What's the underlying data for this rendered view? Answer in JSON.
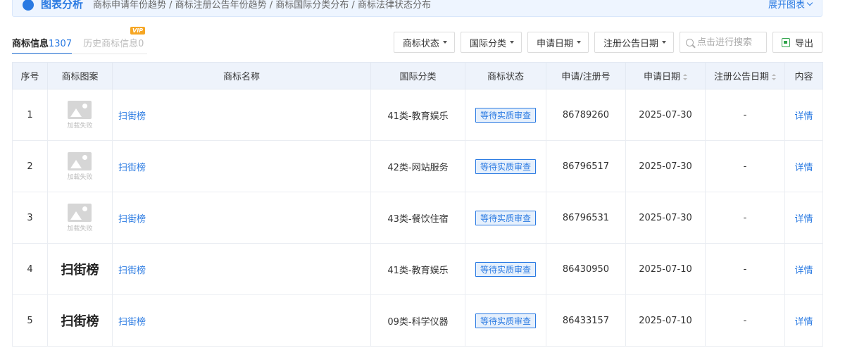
{
  "banner": {
    "title": "图表分析",
    "links": "商标申请年份趋势 / 商标注册公告年份趋势 / 商标国际分类分布 / 商标法律状态分布",
    "expand_label": "展开图表"
  },
  "tabs": [
    {
      "label": "商标信息",
      "count": "1307"
    },
    {
      "label": "历史商标信息",
      "count": "0",
      "badge": "VIP"
    }
  ],
  "toolbar": {
    "filters": [
      "商标状态",
      "国际分类",
      "申请日期",
      "注册公告日期"
    ],
    "search_placeholder": "点击进行搜索",
    "export_label": "导出"
  },
  "table": {
    "headers": [
      "序号",
      "商标图案",
      "商标名称",
      "国际分类",
      "商标状态",
      "申请/注册号",
      "申请日期",
      "注册公告日期",
      "内容"
    ],
    "image_fail_caption": "加载失败",
    "rows": [
      {
        "no": "1",
        "image": "failed",
        "mark_text": "",
        "name": "扫街榜",
        "class": "41类-教育娱乐",
        "status": "等待实质审查",
        "reg_no": "86789260",
        "apply_date": "2025-07-30",
        "announce_date": "-",
        "action": "详情"
      },
      {
        "no": "2",
        "image": "failed",
        "mark_text": "",
        "name": "扫街榜",
        "class": "42类-网站服务",
        "status": "等待实质审查",
        "reg_no": "86796517",
        "apply_date": "2025-07-30",
        "announce_date": "-",
        "action": "详情"
      },
      {
        "no": "3",
        "image": "failed",
        "mark_text": "",
        "name": "扫街榜",
        "class": "43类-餐饮住宿",
        "status": "等待实质审查",
        "reg_no": "86796531",
        "apply_date": "2025-07-30",
        "announce_date": "-",
        "action": "详情"
      },
      {
        "no": "4",
        "image": "text",
        "mark_text": "扫街榜",
        "name": "扫街榜",
        "class": "41类-教育娱乐",
        "status": "等待实质审查",
        "reg_no": "86430950",
        "apply_date": "2025-07-10",
        "announce_date": "-",
        "action": "详情"
      },
      {
        "no": "5",
        "image": "text",
        "mark_text": "扫街榜",
        "name": "扫街榜",
        "class": "09类-科学仪器",
        "status": "等待实质审查",
        "reg_no": "86433157",
        "apply_date": "2025-07-10",
        "announce_date": "-",
        "action": "详情"
      }
    ]
  },
  "colors": {
    "accent": "#2a7ae2",
    "header_bg": "#eef3fb",
    "vip": "#f6a623",
    "export_icon": "#2fa34a"
  },
  "icons": {
    "chart": "chart-pie-icon",
    "expand": "chevron-down-icon",
    "search": "search-icon",
    "export": "excel-icon",
    "sort": "sort-icon",
    "image_fail": "image-placeholder-icon"
  }
}
